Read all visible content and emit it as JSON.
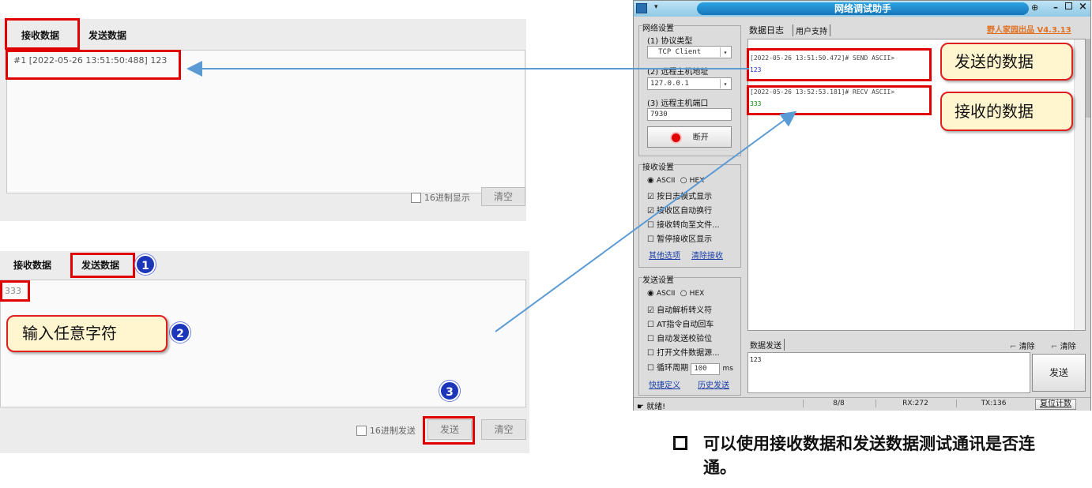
{
  "top_panel": {
    "tab_receive": "接收数据",
    "tab_send": "发送数据",
    "received_line": "#1 [2022-05-26  13:51:50:488] 123",
    "hex_display_label": "16进制显示",
    "clear_label": "清空"
  },
  "bottom_panel": {
    "tab_receive": "接收数据",
    "tab_send": "发送数据",
    "input_value": "333",
    "hex_send_label": "16进制发送",
    "send_label": "发送",
    "clear_label": "清空"
  },
  "steps": [
    "1",
    "2",
    "3"
  ],
  "callout_input": "输入任意字符",
  "callout_sent": "发送的数据",
  "callout_received": "接收的数据",
  "tool_window": {
    "title": "网络调试助手",
    "brand": "野人家园出品 V4.3.13",
    "network_settings": {
      "title": "网络设置",
      "protocol_label": "(1) 协议类型",
      "protocol_value": "TCP Client",
      "host_label": "(2) 远程主机地址",
      "host_value": "127.0.0.1",
      "port_label": "(3) 远程主机端口",
      "port_value": "7930",
      "disconnect_label": "断开"
    },
    "receive_settings": {
      "title": "接收设置",
      "ascii": "ASCII",
      "hex": "HEX",
      "options": [
        {
          "label": "按日志模式显示",
          "checked": true
        },
        {
          "label": "接收区自动换行",
          "checked": true
        },
        {
          "label": "接收转向至文件...",
          "checked": false
        },
        {
          "label": "暂停接收区显示",
          "checked": false
        }
      ],
      "link_more": "其他选项",
      "link_clear": "清除接收"
    },
    "send_settings": {
      "title": "发送设置",
      "ascii": "ASCII",
      "hex": "HEX",
      "options": [
        {
          "label": "自动解析转义符",
          "checked": true
        },
        {
          "label": "AT指令自动回车",
          "checked": false
        },
        {
          "label": "自动发送校验位",
          "checked": false
        },
        {
          "label": "打开文件数据源...",
          "checked": false
        }
      ],
      "loop_label": "循环周期",
      "loop_value": "100",
      "loop_unit": "ms",
      "link_shortcut": "快捷定义",
      "link_history": "历史发送"
    },
    "tabs": [
      "数据日志",
      "用户支持"
    ],
    "log": [
      {
        "header": "[2022-05-26 13:51:50.472]# SEND ASCII>",
        "body": "123",
        "color": "#1a2fd0"
      },
      {
        "header": "[2022-05-26 13:52:53.181]# RECV ASCII>",
        "body": "333",
        "color": "#0a8a0a"
      }
    ],
    "send_area_title": "数据发送",
    "clear_btn_1": "清除",
    "clear_btn_2": "清除",
    "send_area_value": "123",
    "send_button": "发送",
    "status": {
      "ready": "就绪!",
      "counter": "8/8",
      "rx": "RX:272",
      "tx": "TX:136",
      "reset": "复位计数"
    }
  },
  "note": "可以使用接收数据和发送数据测试通讯是否连通。"
}
